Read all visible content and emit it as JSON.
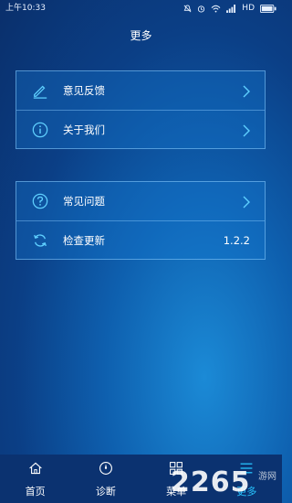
{
  "status_bar": {
    "time": "上午10:33",
    "network": "HD",
    "icons": [
      "mute-icon",
      "alarm-icon",
      "wifi-icon",
      "signal-icon",
      "battery-icon"
    ]
  },
  "header": {
    "title": "更多"
  },
  "menu_group_1": [
    {
      "label": "意见反馈",
      "icon": "edit-icon"
    },
    {
      "label": "关于我们",
      "icon": "info-icon"
    }
  ],
  "menu_group_2": [
    {
      "label": "常见问题",
      "icon": "question-icon"
    },
    {
      "label": "检查更新",
      "icon": "refresh-icon",
      "value": "1.2.2"
    }
  ],
  "tab_bar": {
    "tabs": [
      {
        "label": "首页",
        "icon": "home-icon",
        "active": false
      },
      {
        "label": "诊断",
        "icon": "diagnose-icon",
        "active": false
      },
      {
        "label": "菜单",
        "icon": "menu-icon",
        "active": false
      },
      {
        "label": "更多",
        "icon": "more-icon",
        "active": true
      }
    ]
  },
  "watermark": {
    "digits": "2265",
    "text": "游网"
  },
  "colors": {
    "accent": "#27c4ff",
    "tab_bar_bg": "#0b3270",
    "panel_border": "#8ccdff"
  }
}
